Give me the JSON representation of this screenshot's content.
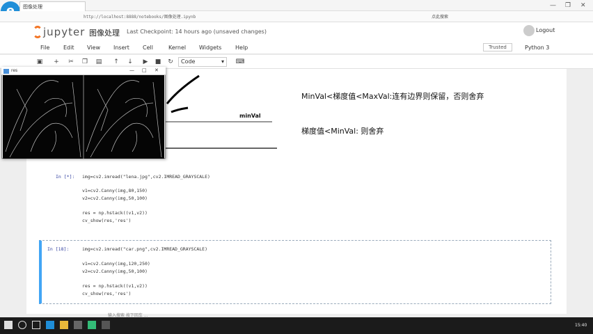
{
  "browser": {
    "tab_title": "图像处理",
    "url": "http://localhost:8888/notebooks/图像处理.ipynb",
    "logo_glyph": "e",
    "search_label": "点此搜索",
    "controls": [
      "—",
      "❐",
      "✕"
    ]
  },
  "jupyter": {
    "logo_text": "jupyter",
    "notebook_title": "图像处理",
    "checkpoint": "Last Checkpoint: 14 hours ago (unsaved changes)",
    "logout": "Logout",
    "menu": [
      "File",
      "Edit",
      "View",
      "Insert",
      "Cell",
      "Kernel",
      "Widgets",
      "Help"
    ],
    "trusted": "Trusted",
    "kernel": "Python 3",
    "cell_type": "Code",
    "toolbar_icons": [
      "save-icon",
      "add-icon",
      "cut-icon",
      "copy-icon",
      "paste-icon",
      "move-up-icon",
      "move-down-icon",
      "run-icon",
      "stop-icon",
      "restart-icon",
      "keyboard-icon"
    ]
  },
  "markdown": {
    "line1": "MinVal<梯度值<MaxVal:连有边界则保留，否则舍弃",
    "line2": "梯度值<MinVal: 则舍弃",
    "minval_label": "minVal"
  },
  "cells": [
    {
      "prompt": "In [*]:",
      "lines": [
        "img=cv2.imread(\"lena.jpg\",cv2.IMREAD_GRAYSCALE)",
        "",
        "v1=cv2.Canny(img,80,150)",
        "v2=cv2.Canny(img,50,100)",
        "",
        "res = np.hstack((v1,v2))",
        "cv_show(res,'res')"
      ]
    },
    {
      "prompt": "In [18]:",
      "lines": [
        "img=cv2.imread(\"car.png\",cv2.IMREAD_GRAYSCALE)",
        "",
        "v1=cv2.Canny(img,120,250)",
        "v2=cv2.Canny(img,50,100)",
        "",
        "res = np.hstack((v1,v2))",
        "cv_show(res,'res')"
      ]
    }
  ],
  "image_window": {
    "title": "res",
    "controls": [
      "—",
      "□",
      "✕"
    ]
  },
  "status_bar": "输入搜索 按下回车 ...",
  "taskbar": {
    "clock": "15:40"
  }
}
